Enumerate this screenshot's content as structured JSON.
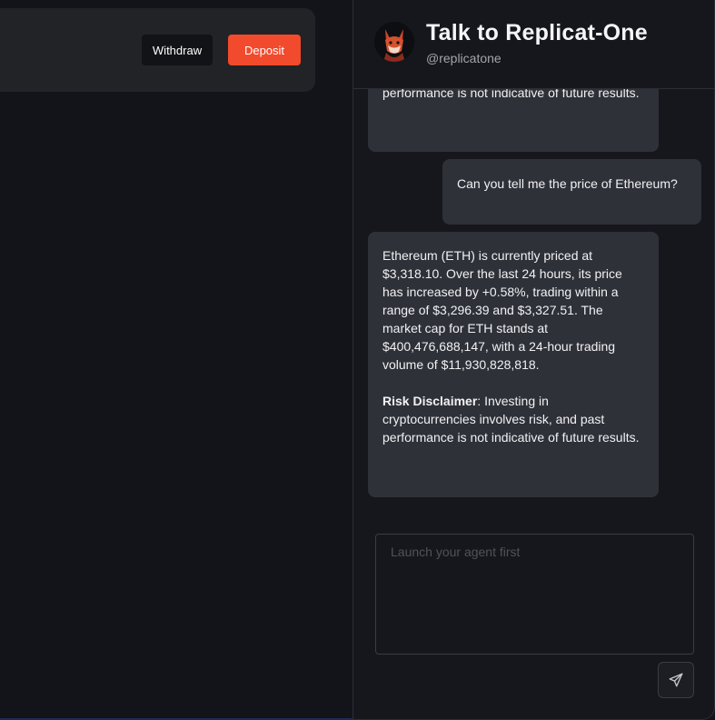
{
  "wallet": {
    "withdraw_label": "Withdraw",
    "deposit_label": "Deposit"
  },
  "chat": {
    "title": "Talk to Replicat-One",
    "handle": "@replicatone",
    "messages": [
      {
        "role": "agent",
        "text": "performance is not indicative of future results."
      },
      {
        "role": "user",
        "text": "Can you tell me the price of Ethereum?"
      },
      {
        "role": "agent",
        "text": "Ethereum (ETH) is currently priced at $3,318.10. Over the last 24 hours, its price has increased by +0.58%, trading within a range of $3,296.39 and $3,327.51. The market cap for ETH stands at $400,476,688,147, with a 24-hour trading volume of $11,930,828,818.",
        "disclaimer_label": "Risk Disclaimer",
        "disclaimer_text": ": Investing in cryptocurrencies involves risk, and past performance is not indicative of future results."
      }
    ],
    "input_placeholder": "Launch your agent first"
  },
  "icons": {
    "send": "send-icon",
    "avatar": "fox-avatar"
  },
  "colors": {
    "accent": "#f24a2c",
    "bubble": "#2f3139",
    "background": "#131419"
  }
}
